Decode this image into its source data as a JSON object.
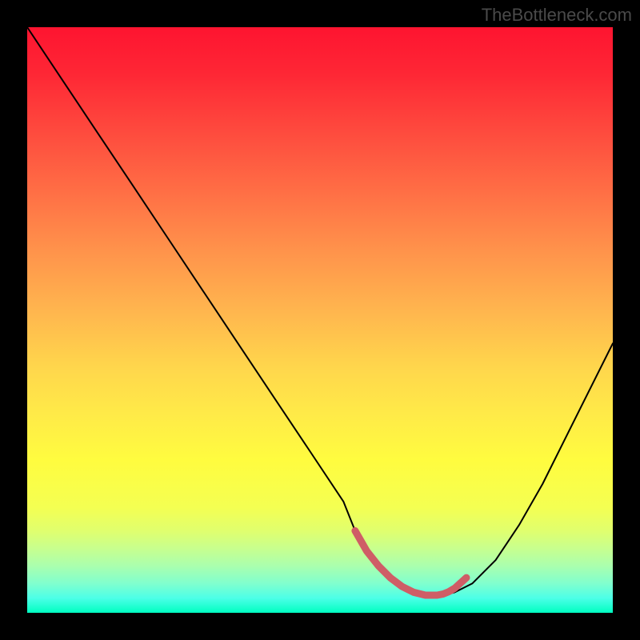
{
  "watermark": "TheBottleneck.com",
  "chart_data": {
    "type": "line",
    "title": "",
    "xlabel": "",
    "ylabel": "",
    "xlim": [
      0,
      100
    ],
    "ylim": [
      0,
      100
    ],
    "gradient_stops": [
      {
        "offset": 0.0,
        "color": "#fe1430"
      },
      {
        "offset": 0.08,
        "color": "#fe2735"
      },
      {
        "offset": 0.18,
        "color": "#fe4b3e"
      },
      {
        "offset": 0.28,
        "color": "#ff6e45"
      },
      {
        "offset": 0.38,
        "color": "#ff924b"
      },
      {
        "offset": 0.48,
        "color": "#ffb44e"
      },
      {
        "offset": 0.58,
        "color": "#ffd64c"
      },
      {
        "offset": 0.66,
        "color": "#ffea48"
      },
      {
        "offset": 0.74,
        "color": "#fffc3f"
      },
      {
        "offset": 0.82,
        "color": "#f4ff52"
      },
      {
        "offset": 0.86,
        "color": "#e0ff6e"
      },
      {
        "offset": 0.89,
        "color": "#c8ff8e"
      },
      {
        "offset": 0.92,
        "color": "#aaffae"
      },
      {
        "offset": 0.95,
        "color": "#80ffce"
      },
      {
        "offset": 0.975,
        "color": "#4cffe7"
      },
      {
        "offset": 1.0,
        "color": "#00ffc1"
      }
    ],
    "series": [
      {
        "name": "bottleneck-curve",
        "color": "#000000",
        "width": 2,
        "x": [
          0,
          6,
          12,
          18,
          24,
          30,
          36,
          42,
          48,
          54,
          56,
          59,
          62,
          65,
          68,
          71,
          73,
          76,
          80,
          84,
          88,
          92,
          96,
          100
        ],
        "values": [
          100,
          91,
          82,
          73,
          64,
          55,
          46,
          37,
          28,
          19,
          14,
          9.5,
          6,
          4,
          3,
          3,
          3.5,
          5,
          9,
          15,
          22,
          30,
          38,
          46
        ]
      },
      {
        "name": "optimal-zone-highlight",
        "color": "#cf5d66",
        "width": 9,
        "x": [
          56,
          58,
          60,
          62,
          64,
          66,
          68,
          70,
          71,
          72,
          73,
          75
        ],
        "values": [
          14,
          10.5,
          8,
          6,
          4.5,
          3.5,
          3,
          3,
          3.2,
          3.6,
          4.2,
          6
        ]
      }
    ]
  }
}
